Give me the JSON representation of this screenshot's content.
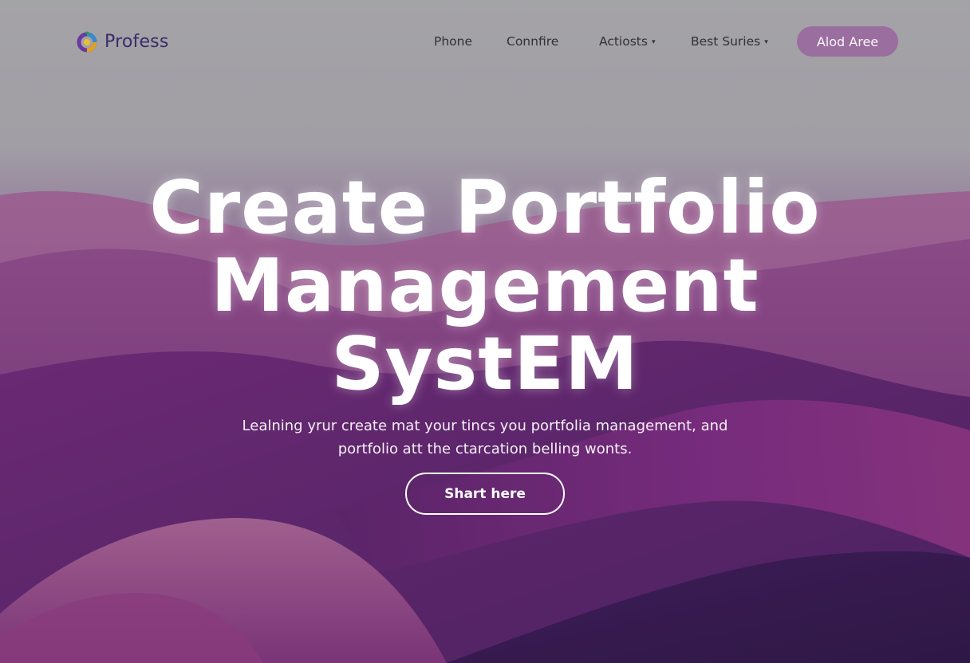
{
  "brand": {
    "name": "Profess",
    "logo_icon": "multicolor-ring-icon"
  },
  "nav": {
    "items": [
      {
        "label": "Phone",
        "has_dropdown": false
      },
      {
        "label": "Connfire",
        "has_dropdown": false
      },
      {
        "label": "Actiosts",
        "has_dropdown": true
      },
      {
        "label": "Best Suries",
        "has_dropdown": true
      }
    ],
    "dropdown_glyph": "▾",
    "cta_label": "Alod Aree"
  },
  "hero": {
    "title_lines": [
      "Create Portfolio",
      "Management",
      "SystEM"
    ],
    "subtitle_lines": [
      "Lealning yrur create mat your tincs you portfolia management, and",
      "portfolio att the ctarcation belling wonts."
    ],
    "cta_label": "Shart here"
  },
  "colors": {
    "top_gray": "#a4a3a6",
    "purple_dark": "#3a1d52",
    "purple_mid": "#6b2a7a",
    "magenta": "#8e3a8c",
    "nav_cta_bg": "#9a6e9e",
    "logo_text": "#3b2c6b"
  }
}
